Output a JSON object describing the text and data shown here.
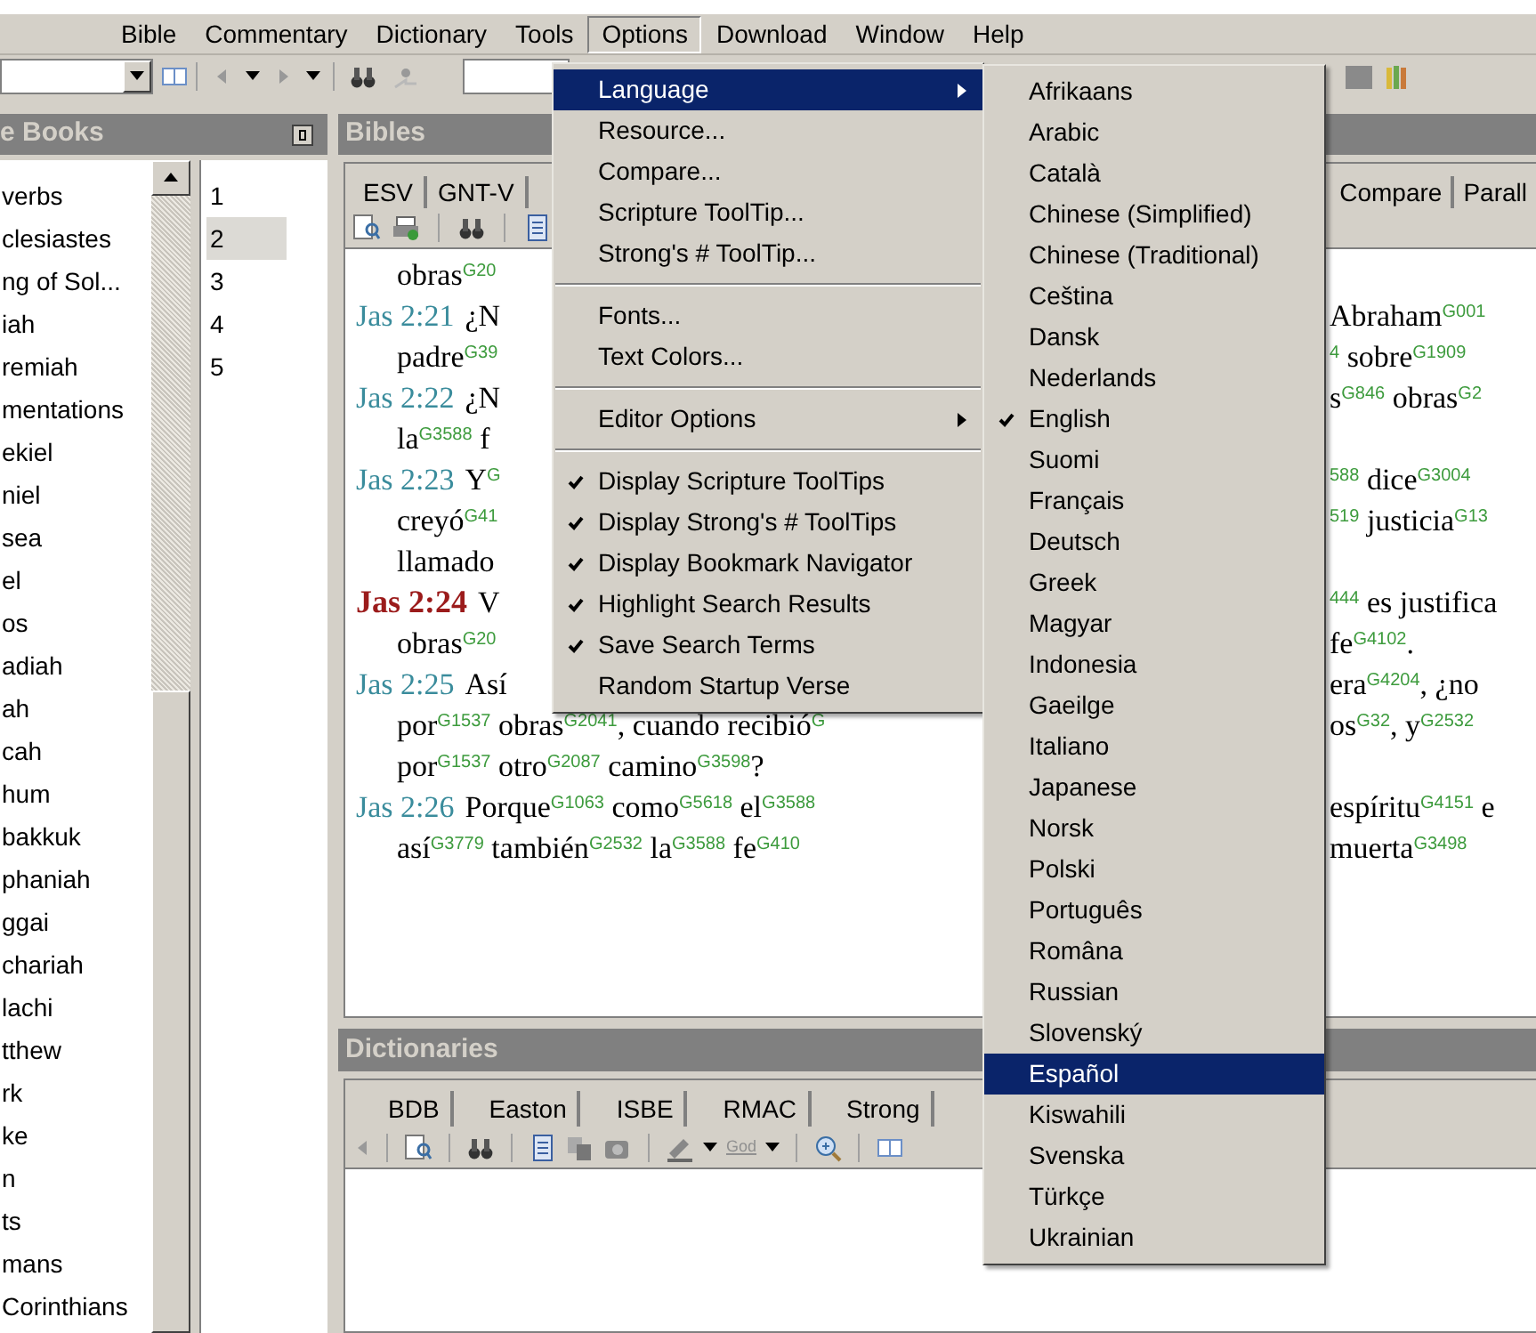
{
  "menu_bar": [
    {
      "label": "Bible",
      "selected": false
    },
    {
      "label": "Commentary",
      "selected": false
    },
    {
      "label": "Dictionary",
      "selected": false
    },
    {
      "label": "Tools",
      "selected": false
    },
    {
      "label": "Options",
      "selected": true
    },
    {
      "label": "Download",
      "selected": false
    },
    {
      "label": "Window",
      "selected": false
    },
    {
      "label": "Help",
      "selected": false
    }
  ],
  "books_panel": {
    "title": "e Books",
    "books": [
      "verbs",
      "clesiastes",
      "ng of Sol...",
      "iah",
      "remiah",
      "mentations",
      "ekiel",
      "niel",
      "sea",
      "el",
      "os",
      "adiah",
      "ah",
      "cah",
      "hum",
      "bakkuk",
      "phaniah",
      "ggai",
      "chariah",
      "lachi",
      "tthew",
      "rk",
      "ke",
      "n",
      "ts",
      "mans",
      "Corinthians"
    ],
    "chapters": [
      {
        "label": "1",
        "selected": false
      },
      {
        "label": "2",
        "selected": true
      },
      {
        "label": "3",
        "selected": false
      },
      {
        "label": "4",
        "selected": false
      },
      {
        "label": "5",
        "selected": false
      }
    ]
  },
  "bibles_panel": {
    "title": "Bibles",
    "tabs": [
      "ESV",
      "GNT-V"
    ],
    "tabs_right": [
      "Compare",
      "Parall"
    ],
    "lines": [
      {
        "text": "obras$^{G20}$"
      },
      {
        "ref": "Jas 2:21",
        "current": false,
        "text": "¿N",
        "right": "Abraham$^{G001}$"
      },
      {
        "text": "padre$^{G39}$",
        "right": "$^{4}$ sobre$^{G1909}$"
      },
      {
        "ref": "Jas 2:22",
        "current": false,
        "text": "¿N",
        "right": "s$^{G846}$ obras$^{G2}$"
      },
      {
        "text": "la$^{G3588}$ f"
      },
      {
        "ref": "Jas 2:23",
        "current": false,
        "text": "Y$^{G}$",
        "right": "$^{588}$ dice$^{G3004}$"
      },
      {
        "text": "creyó$^{G41}$",
        "right": "$^{519}$ justicia$^{G13}$"
      },
      {
        "text": "llamado"
      },
      {
        "ref": "Jas 2:24",
        "current": true,
        "text": "V",
        "right": "$^{444}$ es justifica"
      },
      {
        "text": "obras$^{G20}$",
        "right": "fe$^{G4102}$."
      },
      {
        "ref": "Jas 2:25",
        "current": false,
        "text": "Así",
        "right": "era$^{G4204}$, ¿no"
      },
      {
        "text": "por$^{G1537}$ obras$^{G2041}$, cuando recibió$^{G}$",
        "right": "os$^{G32}$, y$^{G2532}$"
      },
      {
        "text": "por$^{G1537}$ otro$^{G2087}$ camino$^{G3598}$?"
      },
      {
        "ref": "Jas 2:26",
        "current": false,
        "text": "Porque$^{G1063}$ como$^{G5618}$ el$^{G3588}$",
        "right": "espíritu$^{G4151}$ e"
      },
      {
        "text": "así$^{G3779}$ también$^{G2532}$ la$^{G3588}$ fe$^{G410}$",
        "right": "muerta$^{G3498}$"
      }
    ]
  },
  "dictionaries_panel": {
    "title": "Dictionaries",
    "tabs": [
      "BDB",
      "Easton",
      "ISBE",
      "RMAC",
      "Strong"
    ],
    "toolbar_label": "God"
  },
  "options_menu": {
    "groups": [
      [
        {
          "label": "Language",
          "selected": true,
          "checked": false,
          "submenu": true
        },
        {
          "label": "Resource...",
          "selected": false,
          "checked": false,
          "submenu": false
        },
        {
          "label": "Compare...",
          "selected": false,
          "checked": false,
          "submenu": false
        },
        {
          "label": "Scripture ToolTip...",
          "selected": false,
          "checked": false,
          "submenu": false
        },
        {
          "label": "Strong's # ToolTip...",
          "selected": false,
          "checked": false,
          "submenu": false
        }
      ],
      [
        {
          "label": "Fonts...",
          "selected": false,
          "checked": false,
          "submenu": false
        },
        {
          "label": "Text Colors...",
          "selected": false,
          "checked": false,
          "submenu": false
        }
      ],
      [
        {
          "label": "Editor Options",
          "selected": false,
          "checked": false,
          "submenu": true
        }
      ],
      [
        {
          "label": "Display Scripture ToolTips",
          "selected": false,
          "checked": true,
          "submenu": false
        },
        {
          "label": "Display Strong's # ToolTips",
          "selected": false,
          "checked": true,
          "submenu": false
        },
        {
          "label": "Display Bookmark Navigator",
          "selected": false,
          "checked": true,
          "submenu": false
        },
        {
          "label": "Highlight Search Results",
          "selected": false,
          "checked": true,
          "submenu": false
        },
        {
          "label": "Save Search Terms",
          "selected": false,
          "checked": true,
          "submenu": false
        },
        {
          "label": "Random Startup Verse",
          "selected": false,
          "checked": false,
          "submenu": false
        }
      ]
    ]
  },
  "language_menu": {
    "items": [
      {
        "label": "Afrikaans",
        "selected": false,
        "checked": false
      },
      {
        "label": "Arabic",
        "selected": false,
        "checked": false
      },
      {
        "label": "Català",
        "selected": false,
        "checked": false
      },
      {
        "label": "Chinese (Simplified)",
        "selected": false,
        "checked": false
      },
      {
        "label": "Chinese (Traditional)",
        "selected": false,
        "checked": false
      },
      {
        "label": "Ceština",
        "selected": false,
        "checked": false
      },
      {
        "label": "Dansk",
        "selected": false,
        "checked": false
      },
      {
        "label": "Nederlands",
        "selected": false,
        "checked": false
      },
      {
        "label": "English",
        "selected": false,
        "checked": true
      },
      {
        "label": "Suomi",
        "selected": false,
        "checked": false
      },
      {
        "label": "Français",
        "selected": false,
        "checked": false
      },
      {
        "label": "Deutsch",
        "selected": false,
        "checked": false
      },
      {
        "label": "Greek",
        "selected": false,
        "checked": false
      },
      {
        "label": "Magyar",
        "selected": false,
        "checked": false
      },
      {
        "label": "Indonesia",
        "selected": false,
        "checked": false
      },
      {
        "label": "Gaeilge",
        "selected": false,
        "checked": false
      },
      {
        "label": "Italiano",
        "selected": false,
        "checked": false
      },
      {
        "label": "Japanese",
        "selected": false,
        "checked": false
      },
      {
        "label": "Norsk",
        "selected": false,
        "checked": false
      },
      {
        "label": "Polski",
        "selected": false,
        "checked": false
      },
      {
        "label": "Português",
        "selected": false,
        "checked": false
      },
      {
        "label": "Româna",
        "selected": false,
        "checked": false
      },
      {
        "label": "Russian",
        "selected": false,
        "checked": false
      },
      {
        "label": "Slovenský",
        "selected": false,
        "checked": false
      },
      {
        "label": "Español",
        "selected": true,
        "checked": false
      },
      {
        "label": "Kiswahili",
        "selected": false,
        "checked": false
      },
      {
        "label": "Svenska",
        "selected": false,
        "checked": false
      },
      {
        "label": "Türkçe",
        "selected": false,
        "checked": false
      },
      {
        "label": "Ukrainian",
        "selected": false,
        "checked": false
      }
    ]
  }
}
